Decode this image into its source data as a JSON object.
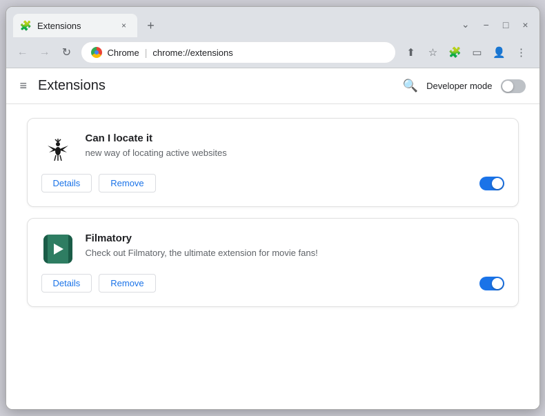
{
  "browser": {
    "tab_title": "Extensions",
    "tab_close_label": "×",
    "new_tab_label": "+",
    "window_controls": {
      "minimize": "−",
      "maximize": "□",
      "close": "×",
      "chevron": "⌄"
    },
    "url_chrome_label": "Chrome",
    "url_separator": "|",
    "url_address": "chrome://extensions",
    "nav": {
      "back": "←",
      "forward": "→",
      "reload": "↻"
    }
  },
  "page": {
    "title": "Extensions",
    "hamburger": "≡",
    "search_label": "🔍",
    "dev_mode_label": "Developer mode",
    "dev_mode_on": false
  },
  "extensions": [
    {
      "id": "ext-locate",
      "name": "Can I locate it",
      "description": "new way of locating active websites",
      "enabled": true,
      "details_label": "Details",
      "remove_label": "Remove"
    },
    {
      "id": "ext-filmatory",
      "name": "Filmatory",
      "description": "Check out Filmatory, the ultimate extension for movie fans!",
      "enabled": true,
      "details_label": "Details",
      "remove_label": "Remove"
    }
  ],
  "colors": {
    "accent": "#1a73e8",
    "toggle_on": "#1a73e8",
    "toggle_off": "#bdc1c6"
  }
}
